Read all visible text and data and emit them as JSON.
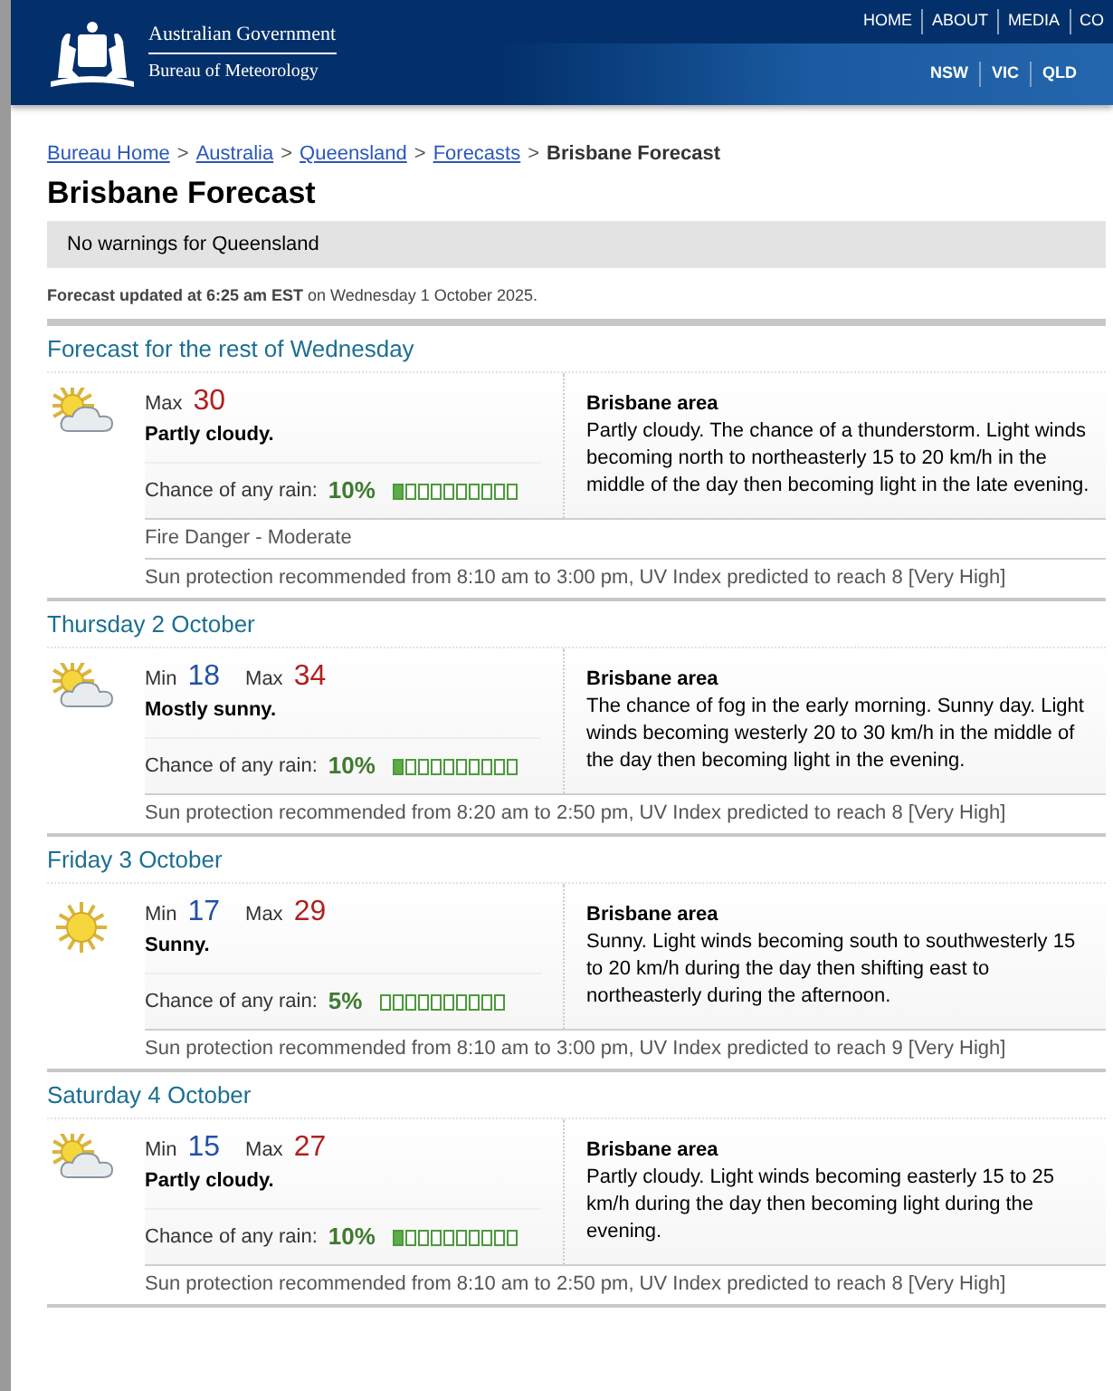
{
  "header": {
    "agency": "Australian Government",
    "bureau": "Bureau of Meteorology",
    "top_nav": [
      "HOME",
      "ABOUT",
      "MEDIA",
      "CO"
    ],
    "state_nav": [
      "NSW",
      "VIC",
      "QLD"
    ]
  },
  "breadcrumb": {
    "links": [
      {
        "label": "Bureau Home",
        "separator": ">"
      },
      {
        "label": "Australia",
        "separator": ">"
      },
      {
        "label": "Queensland",
        "separator": ">"
      },
      {
        "label": "Forecasts",
        "separator": ">"
      }
    ],
    "current": "Brisbane Forecast"
  },
  "title": "Brisbane Forecast",
  "warning": "No warnings for Queensland",
  "updated": "**Forecast updated at 6:25 am EST** on Wednesday 1 October 2025.",
  "days": [
    {
      "heading": "Forecast for the rest of Wednesday",
      "kind": "partly-cloudy",
      "max_label": "Max",
      "max": "30",
      "condition": "Partly cloudy.",
      "rain_label": "Chance of any rain:",
      "rain": "10%",
      "level": 0.1,
      "area": "Brisbane area",
      "text": "Partly cloudy. The chance of a thunderstorm. Light winds becoming north to northeasterly 15 to 20 km/h in the middle of the day then becoming light in the late evening.",
      "notes": [
        "Fire Danger - Moderate",
        "Sun protection recommended from 8:10 am to 3:00 pm, UV Index predicted to reach 8 [Very High]"
      ]
    },
    {
      "heading": "Thursday 2 October",
      "kind": "partly-cloudy",
      "min_label": "Min",
      "min": "18",
      "max_label": "Max",
      "max": "34",
      "condition": "Mostly sunny.",
      "rain_label": "Chance of any rain:",
      "rain": "10%",
      "level": 0.1,
      "area": "Brisbane area",
      "text": "The chance of fog in the early morning. Sunny day. Light winds becoming westerly 20 to 30 km/h in the middle of the day then becoming light in the evening.",
      "notes": [
        "Sun protection recommended from 8:20 am to 2:50 pm, UV Index predicted to reach 8 [Very High]"
      ]
    },
    {
      "heading": "Friday 3 October",
      "kind": "sunny",
      "min_label": "Min",
      "min": "17",
      "max_label": "Max",
      "max": "29",
      "condition": "Sunny.",
      "rain_label": "Chance of any rain:",
      "rain": "5%",
      "area": "Brisbane area",
      "text": "Sunny. Light winds becoming south to southwesterly 15 to 20 km/h during the day then shifting east to northeasterly during the afternoon.",
      "notes": [
        "Sun protection recommended from 8:10 am to 3:00 pm, UV Index predicted to reach 9 [Very High]"
      ]
    },
    {
      "heading": "Saturday 4 October",
      "kind": "partly-cloudy",
      "min_label": "Min",
      "min": "15",
      "max_label": "Max",
      "max": "27",
      "condition": "Partly cloudy.",
      "rain_label": "Chance of any rain:",
      "rain": "10%",
      "level": 0.1,
      "area": "Brisbane area",
      "text": "Partly cloudy. Light winds becoming easterly 15 to 25 km/h during the day then becoming light during the evening.",
      "notes": [
        "Sun protection recommended from 8:10 am to 2:50 pm, UV Index predicted to reach 8 [Very High]"
      ]
    }
  ]
}
